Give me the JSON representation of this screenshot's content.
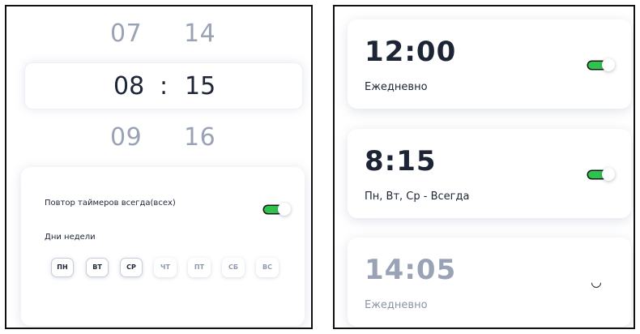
{
  "picker": {
    "prev_hour": "07",
    "prev_minute": "14",
    "hour": "08",
    "separator": ":",
    "minute": "15",
    "next_hour": "09",
    "next_minute": "16"
  },
  "settings": {
    "repeat_label": "Повтор таймеров всегда(всех)",
    "repeat_enabled": true,
    "days_label": "Дни недели",
    "days": [
      {
        "label": "ПН",
        "active": true
      },
      {
        "label": "ВТ",
        "active": true
      },
      {
        "label": "СР",
        "active": true
      },
      {
        "label": "ЧТ",
        "active": false
      },
      {
        "label": "ПТ",
        "active": false
      },
      {
        "label": "СБ",
        "active": false
      },
      {
        "label": "ВС",
        "active": false
      }
    ]
  },
  "alarms": [
    {
      "time": "12:00",
      "repeat": "Ежедневно",
      "enabled": true
    },
    {
      "time": "8:15",
      "repeat": "Пн, Вт, Ср - Всегда",
      "enabled": true
    },
    {
      "time": "14:05",
      "repeat": "Ежедневно",
      "enabled": false
    }
  ],
  "colors": {
    "toggle_on": "#2fc24e",
    "text_primary": "#1c2436",
    "text_muted": "#9aa3b5"
  }
}
